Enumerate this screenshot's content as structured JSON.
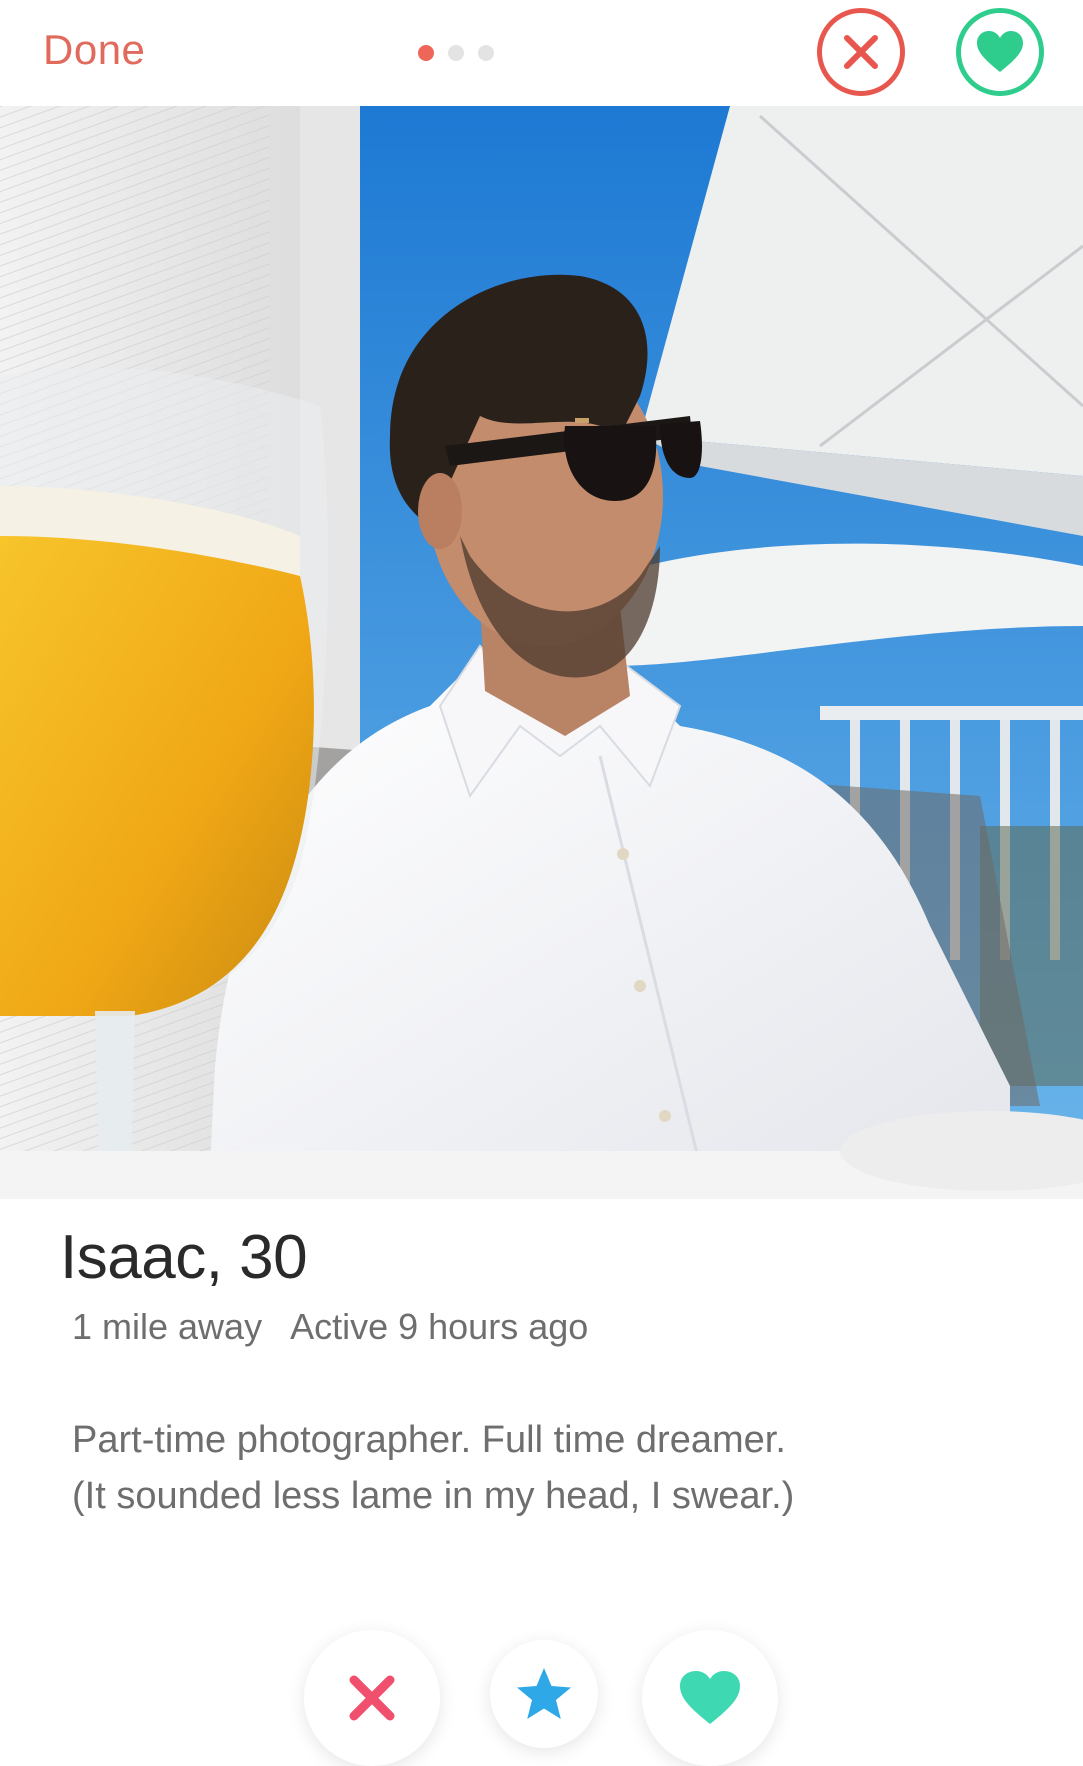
{
  "header": {
    "done_label": "Done",
    "photo_count": 3,
    "active_photo_index": 0,
    "nope_icon": "close-icon",
    "like_icon": "heart-icon"
  },
  "profile": {
    "name_age": "Isaac, 30",
    "distance": "1 mile away",
    "last_active": "Active 9 hours ago",
    "bio_lines": [
      "Part-time photographer. Full time dreamer.",
      "(It sounded less lame in my head, I swear.)"
    ]
  },
  "actions": {
    "nope_icon": "x-icon",
    "super_like_icon": "star-icon",
    "like_icon": "heart-icon"
  },
  "colors": {
    "done": "#e06a5c",
    "nope": "#e8574d",
    "like": "#2ecd8e",
    "super_like": "#2fa8e8",
    "active_dot": "#ee6658"
  }
}
